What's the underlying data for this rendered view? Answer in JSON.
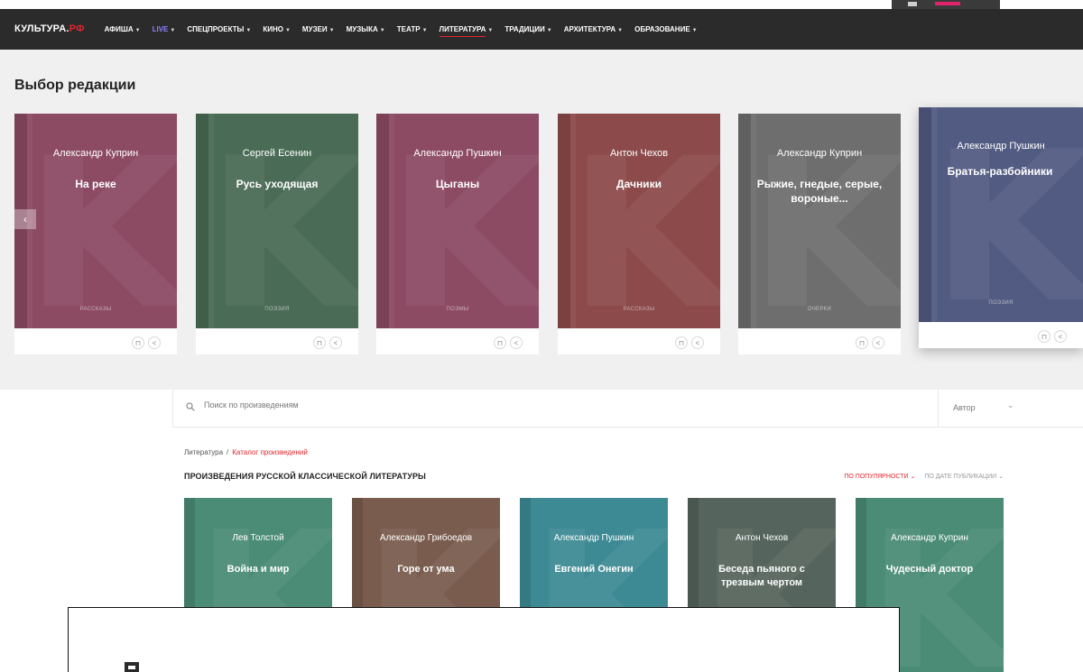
{
  "nav": {
    "logo_main": "КУЛЬТУРА.",
    "logo_accent": "РФ",
    "items": [
      {
        "label": "АФИША"
      },
      {
        "label": "LIVE"
      },
      {
        "label": "СПЕЦПРОЕКТЫ"
      },
      {
        "label": "КИНО"
      },
      {
        "label": "МУЗЕИ"
      },
      {
        "label": "МУЗЫКА"
      },
      {
        "label": "ТЕАТР"
      },
      {
        "label": "ЛИТЕРАТУРА"
      },
      {
        "label": "ТРАДИЦИИ"
      },
      {
        "label": "АРХИТЕКТУРА"
      },
      {
        "label": "ОБРАЗОВАНИЕ"
      }
    ]
  },
  "editors": {
    "title": "Выбор редакции",
    "books": [
      {
        "author": "Александр Куприн",
        "title": "На реке",
        "genre": "РАССКАЗЫ",
        "color": "#8c4a63"
      },
      {
        "author": "Сергей Есенин",
        "title": "Русь уходящая",
        "genre": "ПОЭЗИЯ",
        "color": "#4a6b56"
      },
      {
        "author": "Александр Пушкин",
        "title": "Цыганы",
        "genre": "ПОЭМЫ",
        "color": "#8c4a63"
      },
      {
        "author": "Антон Чехов",
        "title": "Дачники",
        "genre": "РАССКАЗЫ",
        "color": "#8c4a4a"
      },
      {
        "author": "Александр Куприн",
        "title": "Рыжие, гнедые, серые, вороные...",
        "genre": "ОЧЕРКИ",
        "color": "#6e6e6e"
      },
      {
        "author": "Александр Пушкин",
        "title": "Братья-разбойники",
        "genre": "ПОЭЗИЯ",
        "color": "#525b82"
      }
    ]
  },
  "search": {
    "placeholder": "Поиск по произведениям",
    "author_label": "Автор"
  },
  "breadcrumb": {
    "root": "Литература",
    "separator": "/",
    "current": "Каталог произведений"
  },
  "catalog": {
    "title": "ПРОИЗВЕДЕНИЯ РУССКОЙ КЛАССИЧЕСКОЙ ЛИТЕРАТУРЫ",
    "sort_popular": "ПО ПОПУЛЯРНОСТИ",
    "sort_date": "ПО ДАТЕ ПУБЛИКАЦИИ",
    "books": [
      {
        "author": "Лев Толстой",
        "title": "Война и мир",
        "color": "#4a8c76"
      },
      {
        "author": "Александр Грибоедов",
        "title": "Горе от ума",
        "color": "#7a5c4e"
      },
      {
        "author": "Александр Пушкин",
        "title": "Евгений Онегин",
        "color": "#3d8a94"
      },
      {
        "author": "Антон Чехов",
        "title": "Беседа пьяного с трезвым чертом",
        "color": "#55645c"
      },
      {
        "author": "Александр Куприн",
        "title": "Чудесный доктор",
        "color": "#4a8c76"
      }
    ]
  }
}
